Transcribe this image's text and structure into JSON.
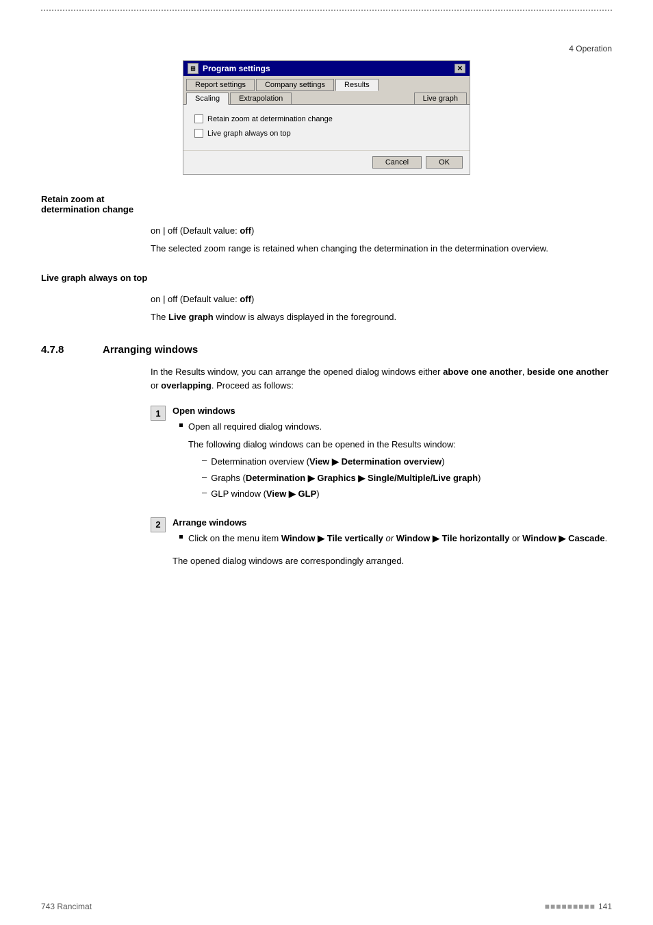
{
  "page": {
    "header_right": "4 Operation",
    "footer_left": "743 Rancimat",
    "footer_right": "141",
    "footer_dots": "■■■■■■■■■"
  },
  "dialog": {
    "title": "Program settings",
    "icon_text": "■■",
    "close_btn": "✕",
    "tabs_row1": [
      {
        "label": "Report settings",
        "active": false
      },
      {
        "label": "Company settings",
        "active": false
      },
      {
        "label": "Results",
        "active": true
      }
    ],
    "tabs_row2": [
      {
        "label": "Scaling",
        "active": true
      },
      {
        "label": "Extrapolation",
        "active": false
      },
      {
        "label": "Live graph",
        "active": false
      }
    ],
    "checkboxes": [
      {
        "label": "Retain zoom at determination change",
        "checked": false
      },
      {
        "label": "Live graph always on top",
        "checked": false
      }
    ],
    "buttons": [
      {
        "label": "Cancel"
      },
      {
        "label": "OK"
      }
    ]
  },
  "sections": [
    {
      "heading": "Retain zoom at determination change",
      "default_line": "on | off (Default value: off)",
      "description": "The selected zoom range is retained when changing the determination in the determination overview."
    },
    {
      "heading": "Live graph always on top",
      "default_line": "on | off (Default value: off)",
      "description": "The Live graph window is always displayed in the foreground."
    }
  ],
  "chapter": {
    "number": "4.7.8",
    "title": "Arranging windows",
    "intro": "In the Results window, you can arrange the opened dialog windows either above one another, beside one another or overlapping. Proceed as follows:"
  },
  "steps": [
    {
      "number": "1",
      "title": "Open windows",
      "bullet": "Open all required dialog windows.",
      "bullet_sub": "The following dialog windows can be opened in the Results window:",
      "sub_items": [
        {
          "text": "Determination overview (View ▶ Determination overview)"
        },
        {
          "text": "Graphs (Determination ▶ Graphics ▶ Single/Multiple/Live graph)"
        },
        {
          "text": "GLP window (View ▶ GLP)"
        }
      ]
    },
    {
      "number": "2",
      "title": "Arrange windows",
      "bullet": "Click on the menu item Window ▶ Tile vertically or Window ▶ Tile horizontally or Window ▶ Cascade.",
      "footer_text": "The opened dialog windows are correspondingly arranged."
    }
  ],
  "labels": {
    "retain_zoom_heading": "Retain zoom at determination change",
    "live_graph_heading": "Live graph always on top",
    "default_off_1": "on | off (Default value: ",
    "default_off_bold": "off",
    "default_off_2": ")",
    "retain_desc": "The selected zoom range is retained when changing the determination in the determination overview.",
    "live_graph_desc_1": "The ",
    "live_graph_desc_bold": "Live graph",
    "live_graph_desc_2": " window is always displayed in the foreground.",
    "chapter_intro_1": "In the Results window, you can arrange the opened dialog windows either ",
    "chapter_intro_bold1": "above one another",
    "chapter_intro_2": ", ",
    "chapter_intro_bold2": "beside one another",
    "chapter_intro_3": " or ",
    "chapter_intro_bold3": "overlapping",
    "chapter_intro_4": ". Proceed as follows:",
    "step1_title": "Open windows",
    "step1_bullet": "Open all required dialog windows.",
    "step1_sub": "The following dialog windows can be opened in the Results window:",
    "sub1_plain1": "Determination overview (",
    "sub1_bold": "View ▶ Determination overview",
    "sub1_plain2": ")",
    "sub2_plain1": "Graphs (",
    "sub2_bold": "Determination ▶ Graphics ▶ Single/Multiple/Live graph",
    "sub2_plain2": ")",
    "sub3_plain1": "GLP window (",
    "sub3_bold": "View ▶ GLP",
    "sub3_plain2": ")",
    "step2_title": "Arrange windows",
    "step2_bullet1": "Click on the menu item ",
    "step2_bold1": "Window ▶ Tile vertically",
    "step2_italic": " or ",
    "step2_bold2": "Window ▶ Tile horizontally",
    "step2_or2": " or ",
    "step2_bold3": "Window ▶ Cascade",
    "step2_bullet2": ".",
    "step2_footer": "The opened dialog windows are correspondingly arranged."
  }
}
